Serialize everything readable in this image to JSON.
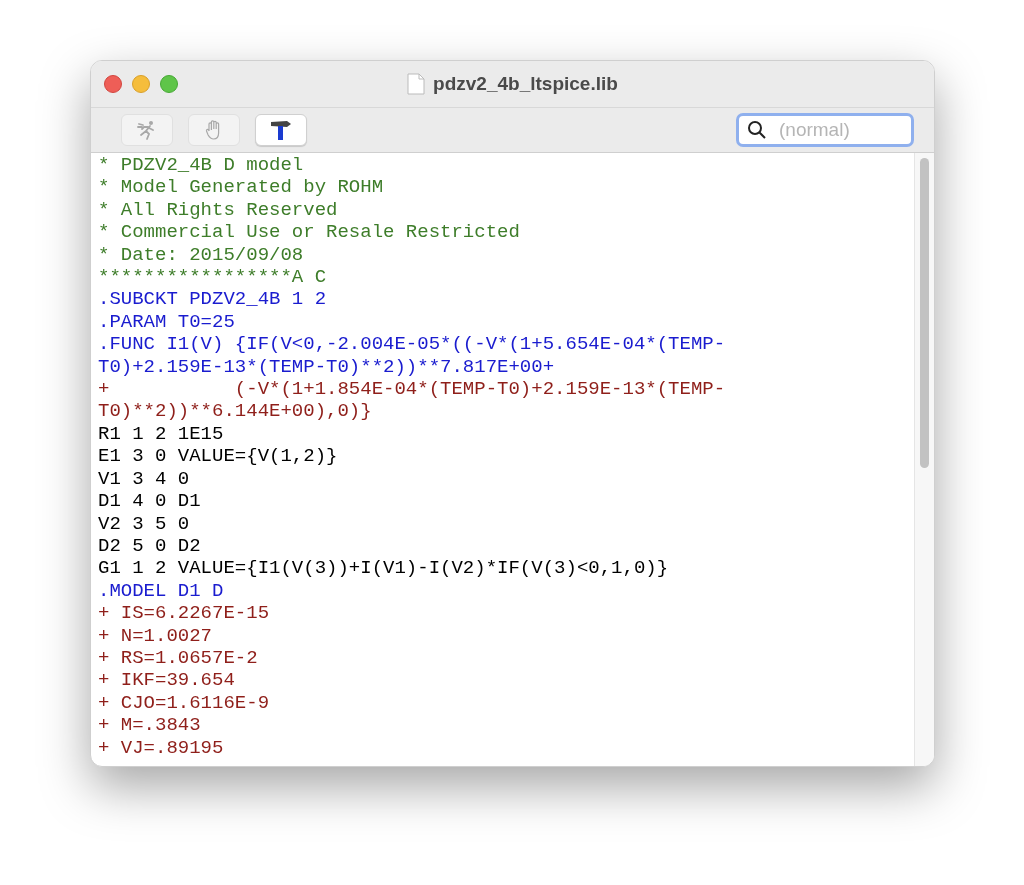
{
  "window": {
    "title": "pdzv2_4b_ltspice.lib"
  },
  "toolbar": [
    {
      "kind": "run",
      "disabled": true
    },
    {
      "kind": "halt",
      "disabled": true
    },
    {
      "kind": "hammer",
      "disabled": false
    }
  ],
  "search": {
    "placeholder": "(normal)"
  },
  "lines": [
    {
      "kind": "comment",
      "text": "* PDZV2_4B D model"
    },
    {
      "kind": "comment",
      "text": "* Model Generated by ROHM"
    },
    {
      "kind": "comment",
      "text": "* All Rights Reserved"
    },
    {
      "kind": "comment",
      "text": "* Commercial Use or Resale Restricted"
    },
    {
      "kind": "comment",
      "text": "* Date: 2015/09/08"
    },
    {
      "kind": "comment",
      "text": "*****************A C"
    },
    {
      "kind": "directive",
      "text": ".SUBCKT PDZV2_4B 1 2"
    },
    {
      "kind": "directive",
      "text": ".PARAM T0=25"
    },
    {
      "kind": "directive",
      "text": ".FUNC I1(V) {IF(V<0,-2.004E-05*((-V*(1+5.654E-04*(TEMP-T0)+2.159E-13*(TEMP-T0)**2))**7.817E+00+"
    },
    {
      "kind": "continuation",
      "text": "+           (-V*(1+1.854E-04*(TEMP-T0)+2.159E-13*(TEMP-T0)**2))**6.144E+00),0)}"
    },
    {
      "kind": "element",
      "text": "R1 1 2 1E15"
    },
    {
      "kind": "element",
      "text": "E1 3 0 VALUE={V(1,2)}"
    },
    {
      "kind": "element",
      "text": "V1 3 4 0"
    },
    {
      "kind": "element",
      "text": "D1 4 0 D1"
    },
    {
      "kind": "element",
      "text": "V2 3 5 0"
    },
    {
      "kind": "element",
      "text": "D2 5 0 D2"
    },
    {
      "kind": "element",
      "text": "G1 1 2 VALUE={I1(V(3))+I(V1)-I(V2)*IF(V(3)<0,1,0)}"
    },
    {
      "kind": "directive",
      "text": ".MODEL D1 D"
    },
    {
      "kind": "continuation",
      "text": "+ IS=6.2267E-15"
    },
    {
      "kind": "continuation",
      "text": "+ N=1.0027"
    },
    {
      "kind": "continuation",
      "text": "+ RS=1.0657E-2"
    },
    {
      "kind": "continuation",
      "text": "+ IKF=39.654"
    },
    {
      "kind": "continuation",
      "text": "+ CJO=1.6116E-9"
    },
    {
      "kind": "continuation",
      "text": "+ M=.3843"
    },
    {
      "kind": "continuation",
      "text": "+ VJ=.89195"
    }
  ]
}
